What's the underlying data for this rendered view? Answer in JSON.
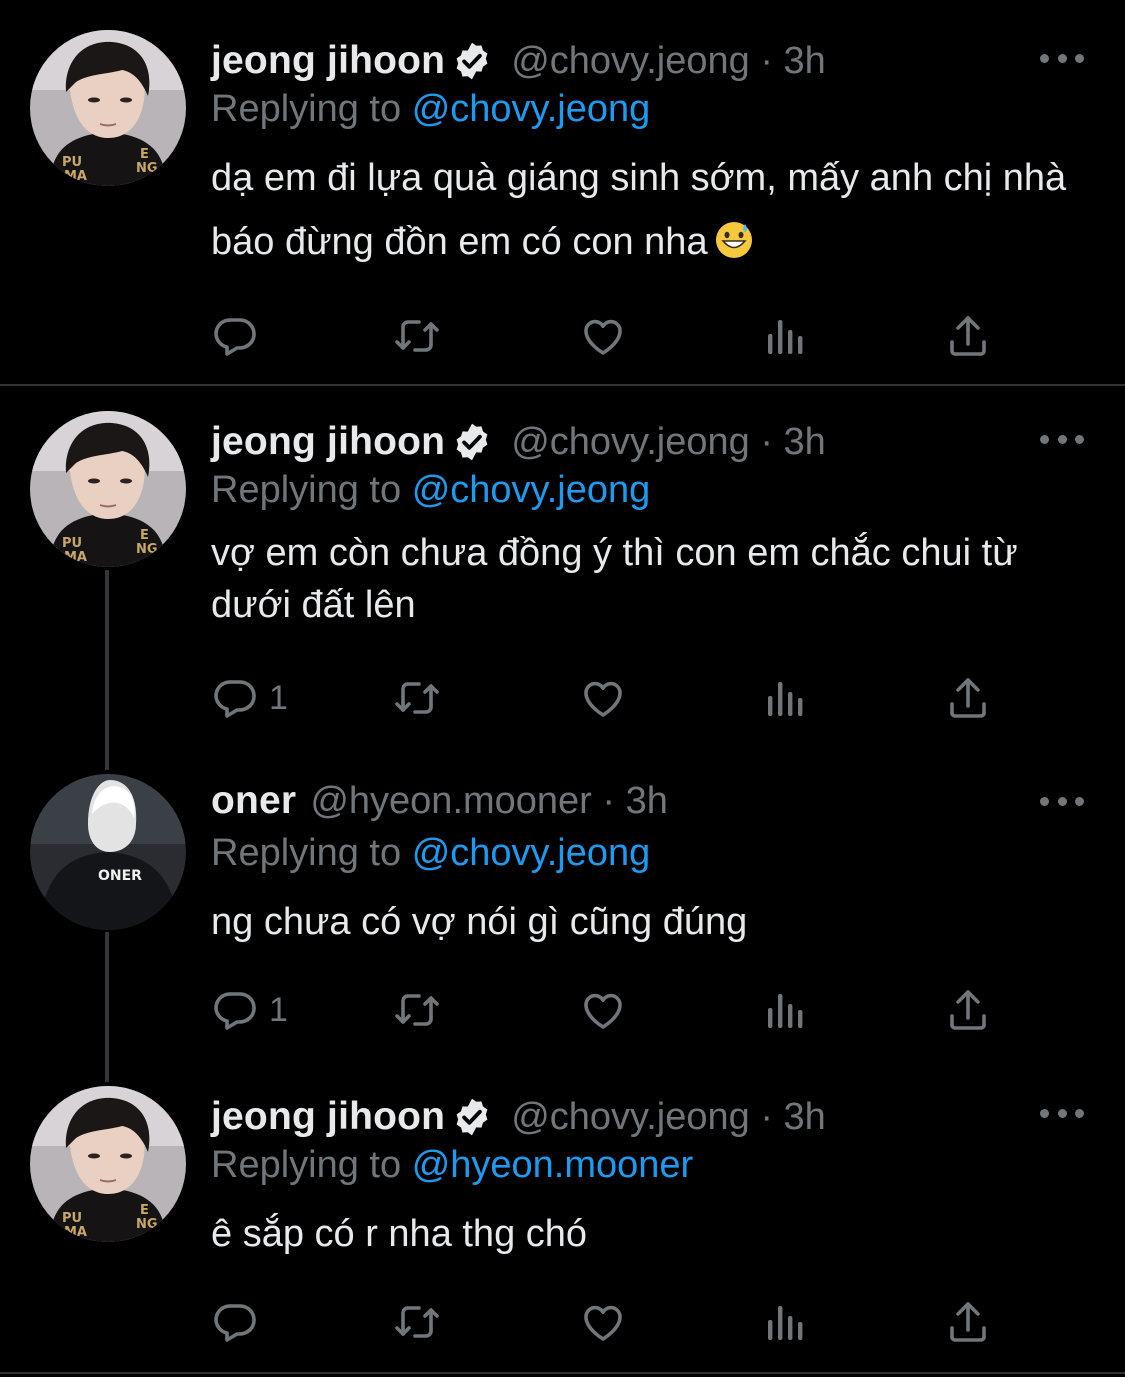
{
  "theme": {
    "background": "#000000",
    "text": "#e7e9ea",
    "muted": "#71767b",
    "accent": "#1d9bf0",
    "verified": "#e7e9ea"
  },
  "tweets": [
    {
      "name": "jeong jihoon",
      "verified": true,
      "handle": "@chovy.jeong",
      "time": "3h",
      "handle_line": "@chovy.jeong · 3h",
      "replying_prefix": "Replying to",
      "replying_to": "@chovy.jeong",
      "text": "dạ em đi lựa quà giáng sinh sớm, mấy anh chị nhà báo đừng đồn em có con nha",
      "emoji": "grinning-sweat-emoji",
      "reply_count": ""
    },
    {
      "name": "jeong jihoon",
      "verified": true,
      "handle": "@chovy.jeong",
      "time": "3h",
      "handle_line": "@chovy.jeong · 3h",
      "replying_prefix": "Replying to",
      "replying_to": "@chovy.jeong",
      "text": "vợ em còn chưa đồng ý thì con em chắc chui từ dưới đất lên",
      "reply_count": "1"
    },
    {
      "name": "oner",
      "verified": false,
      "handle": "@hyeon.mooner",
      "time": "3h",
      "handle_line": "@hyeon.mooner · 3h",
      "replying_prefix": "Replying to",
      "replying_to": "@chovy.jeong",
      "text": "ng chưa có vợ nói gì cũng đúng",
      "avatar_jersey_text": "ONER",
      "reply_count": "1"
    },
    {
      "name": "jeong jihoon",
      "verified": true,
      "handle": "@chovy.jeong",
      "time": "3h",
      "handle_line": "@chovy.jeong · 3h",
      "replying_prefix": "Replying to",
      "replying_to": "@hyeon.mooner",
      "text": "ê sắp có r nha thg chó",
      "reply_count": ""
    }
  ],
  "action_icons": [
    "reply-icon",
    "retweet-icon",
    "like-icon",
    "views-icon",
    "share-icon"
  ]
}
